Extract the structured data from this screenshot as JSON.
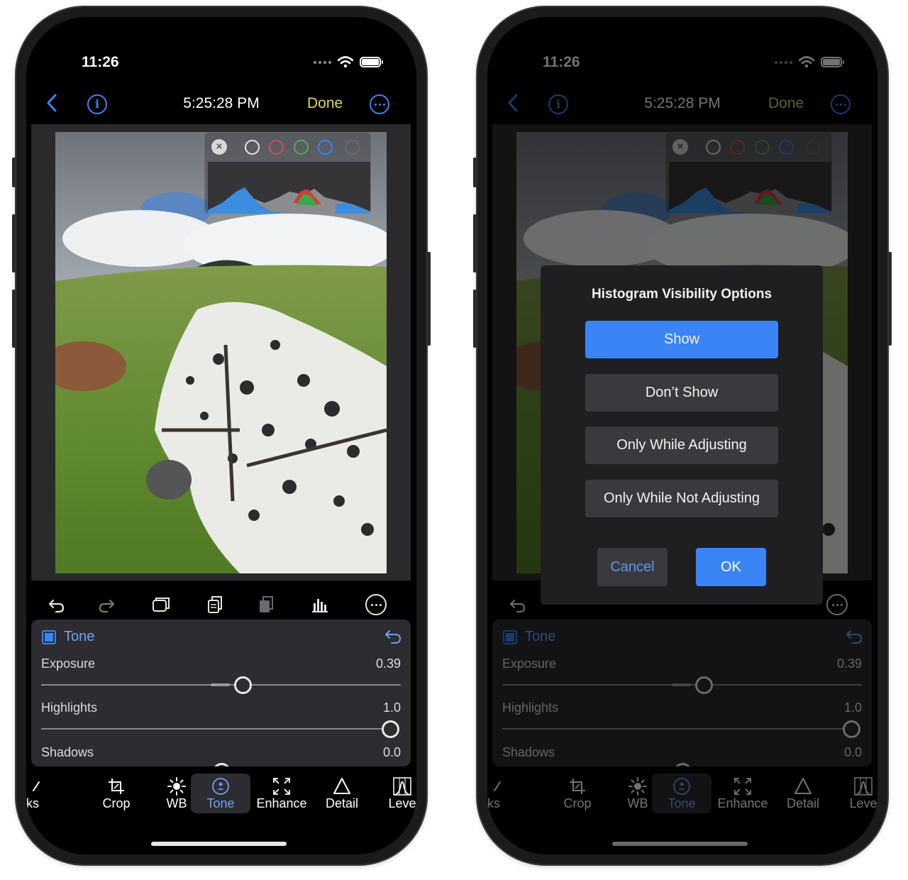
{
  "status": {
    "time": "11:26"
  },
  "nav": {
    "title": "5:25:28 PM",
    "done": "Done"
  },
  "panel": {
    "title": "Tone",
    "rows": [
      {
        "label": "Exposure",
        "value": "0.39",
        "level": 0.56
      },
      {
        "label": "Highlights",
        "value": "1.0",
        "level": 1.0
      },
      {
        "label": "Shadows",
        "value": "0.0",
        "level": 0.5
      }
    ]
  },
  "tabs": [
    {
      "label": "sks",
      "icon": "brush-icon"
    },
    {
      "label": "Crop",
      "icon": "crop-icon"
    },
    {
      "label": "WB",
      "icon": "sun-icon"
    },
    {
      "label": "Tone",
      "icon": "plus-minus-icon",
      "active": true
    },
    {
      "label": "Enhance",
      "icon": "expand-icon"
    },
    {
      "label": "Detail",
      "icon": "triangle-icon"
    },
    {
      "label": "Leve",
      "icon": "levels-icon"
    }
  ],
  "histogram": {
    "channels": [
      "luminance",
      "red",
      "green",
      "blue"
    ]
  },
  "dialog": {
    "title": "Histogram Visibility Options",
    "options": [
      "Show",
      "Don’t Show",
      "Only While Adjusting",
      "Only While Not Adjusting"
    ],
    "selected": "Show",
    "cancel": "Cancel",
    "ok": "OK"
  },
  "colors": {
    "accent": "#3a84f6",
    "done": "#e3d64b",
    "panel": "#2c2c31"
  }
}
